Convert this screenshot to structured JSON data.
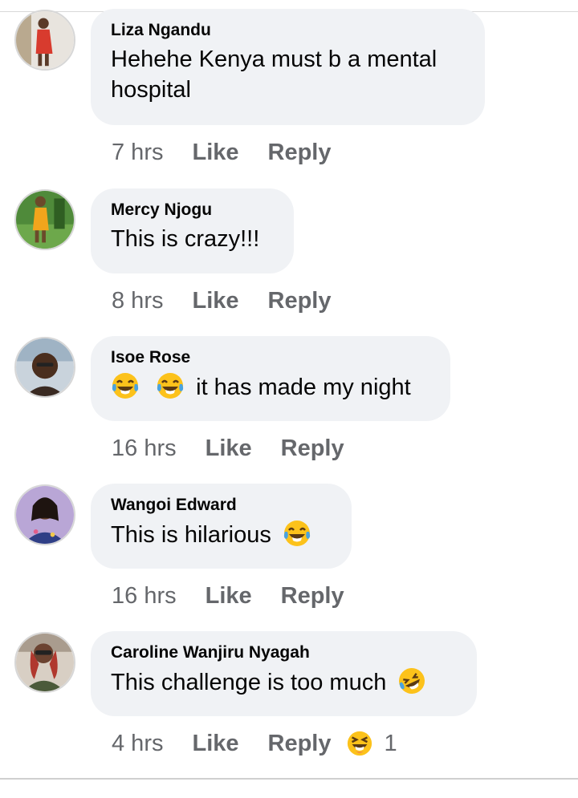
{
  "comments": [
    {
      "author": "Liza Ngandu",
      "text_lines": [
        "Hehehe Kenya must b a mental",
        "hospital"
      ],
      "time": "7 hrs",
      "like_label": "Like",
      "reply_label": "Reply",
      "avatar_icon": "user-avatar-icon"
    },
    {
      "author": "Mercy Njogu",
      "text": "This is crazy!!!",
      "time": "8 hrs",
      "like_label": "Like",
      "reply_label": "Reply",
      "avatar_icon": "user-avatar-icon"
    },
    {
      "author": "Isoe Rose",
      "text": "it has made my night",
      "leading_emojis": [
        "tears-of-joy-emoji",
        "tears-of-joy-emoji"
      ],
      "time": "16 hrs",
      "like_label": "Like",
      "reply_label": "Reply",
      "avatar_icon": "user-avatar-icon"
    },
    {
      "author": "Wangoi Edward",
      "text": "This is hilarious",
      "trailing_emoji": "tears-of-joy-emoji",
      "time": "16 hrs",
      "like_label": "Like",
      "reply_label": "Reply",
      "avatar_icon": "user-avatar-icon"
    },
    {
      "author": "Caroline Wanjiru Nyagah",
      "text": "This challenge is too much",
      "trailing_emoji": "rolling-laughing-emoji",
      "time": "4 hrs",
      "like_label": "Like",
      "reply_label": "Reply",
      "reaction_icon": "haha-reaction-icon",
      "reaction_count": "1",
      "avatar_icon": "user-avatar-icon"
    }
  ],
  "colors": {
    "bubble_bg": "#f0f2f5",
    "meta_text": "#65676b",
    "primary_text": "#050505",
    "emoji_yellow": "#fcc21b"
  }
}
